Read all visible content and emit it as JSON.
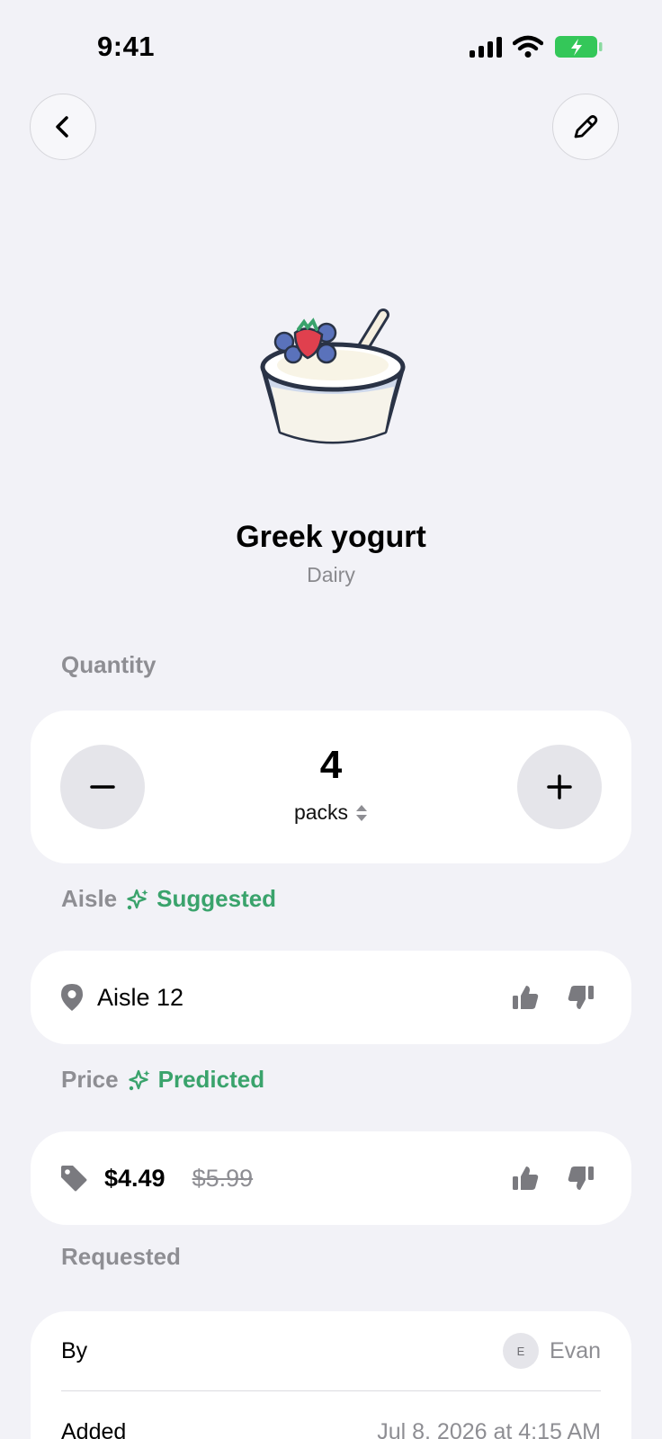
{
  "status_bar": {
    "time": "9:41"
  },
  "item": {
    "title": "Greek yogurt",
    "category": "Dairy"
  },
  "quantity": {
    "label": "Quantity",
    "value": "4",
    "unit": "packs"
  },
  "aisle": {
    "label": "Aisle",
    "badge": "Suggested",
    "value": "Aisle 12"
  },
  "price": {
    "label": "Price",
    "badge": "Predicted",
    "current": "$4.49",
    "original": "$5.99"
  },
  "requested": {
    "label": "Requested",
    "by_label": "By",
    "by_initial": "E",
    "by_value": "Evan",
    "added_label": "Added",
    "added_value": "Jul 8, 2026 at 4:15 AM"
  },
  "colors": {
    "accent_green": "#3aa36c",
    "battery_green": "#34c759",
    "background": "#f2f2f7"
  },
  "icons": [
    "chevron-left-icon",
    "pencil-icon",
    "location-pin-icon",
    "price-tag-icon",
    "thumbs-up-icon",
    "thumbs-down-icon",
    "sparkles-icon",
    "minus-icon",
    "plus-icon",
    "updown-icon"
  ]
}
